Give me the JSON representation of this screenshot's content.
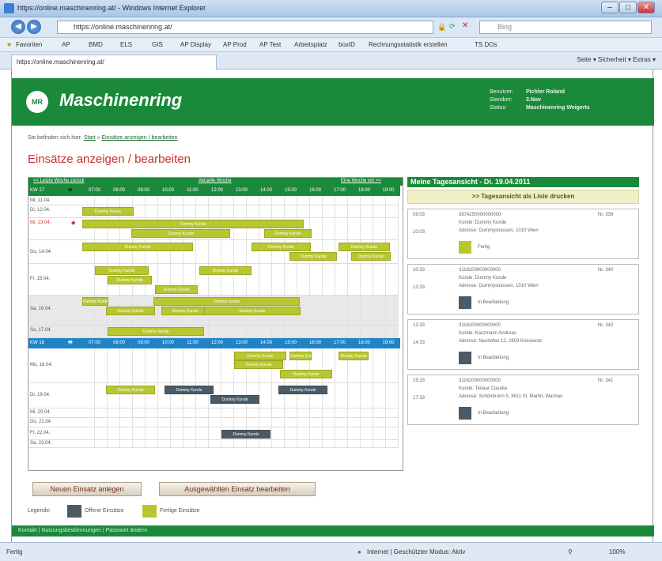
{
  "window": {
    "title": "https://online.maschinenring.at/ - Windows Internet Explorer",
    "url": "https://online.maschinenring.at/",
    "search_placeholder": "Bing"
  },
  "favorites": {
    "label": "Favoriten",
    "items": [
      "AP",
      "BMD",
      "ELS",
      "GIS",
      "AP Display",
      "AP Prod",
      "AP Test",
      "Arbeitsplatz",
      "boxID",
      "Rechnungsstatistik erstellen",
      "TS DOs"
    ]
  },
  "tab": {
    "label": "https://online.maschinenring.at/",
    "tools": "Seite ▾  Sicherheit ▾  Extras ▾"
  },
  "header": {
    "brand": "Maschinenring",
    "logo_text": "MR",
    "user_labels": [
      "Benutzer:",
      "Standort:",
      "Status:"
    ],
    "user_values": [
      "Pichler Roland",
      "3.Nov",
      "Maschinenring Weigerts"
    ]
  },
  "breadcrumb": {
    "prefix": "Sie befinden sich hier:",
    "start": "Start",
    "current": "Einsätze anzeigen / bearbeiten"
  },
  "page_title": "Einsätze anzeigen / bearbeiten",
  "calendar": {
    "prev_week": "<< Letzte Woche zurück",
    "current_week": "Aktuelle Woche",
    "next_week": "Eine Woche vor >>",
    "week1": "KW 17",
    "week2": "KW 18",
    "hours": [
      "07:00",
      "08:00",
      "09:00",
      "10:00",
      "11:00",
      "12:00",
      "13:00",
      "14:00",
      "15:00",
      "16:00",
      "17:00",
      "18:00",
      "19:00"
    ],
    "days1": [
      "Mi, 11.04.",
      "Di, 12.04.",
      "Mi, 13.04.",
      "Do, 14.04.",
      "Fr, 15.04.",
      "Sa, 16.04.",
      "So, 17.04."
    ],
    "days2": [
      "Mo, 18.04.",
      "Di, 19.04.",
      "Mi, 20.04.",
      "Do, 21.04.",
      "Fr, 22.04.",
      "Sa, 23.04."
    ],
    "event_labels": {
      "green": "Dummy Kunde",
      "dark": "Dummy Kunde"
    }
  },
  "buttons": {
    "new": "Neuen Einsatz anlegen",
    "edit": "Ausgewählten Einsatz bearbeiten"
  },
  "legend": {
    "label": "Legende:",
    "open": "Offene Einsätze",
    "done": "Fertige Einsätze",
    "open_color": "#4a5a66",
    "done_color": "#b8c630"
  },
  "day_view": {
    "title": "Meine Tagesansicht - Di. 19.04.2011",
    "print": ">> Tagesansicht als Liste drucken",
    "cards": [
      {
        "t1": "09:03",
        "t2": "10:03",
        "id": "3874250000000000",
        "nr": "Nr. 339",
        "kunde": "Kunde: Dummy Kunde",
        "adresse": "Adresse: Dummystrassen, 1010 Wien",
        "status": "Fertig",
        "color": "#b8c630"
      },
      {
        "t1": "10:33",
        "t2": "12:33",
        "id": "3116200000000000",
        "nr": "Nr. 340",
        "kunde": "Kunde: Dummy Kunde",
        "adresse": "Adresse: Dummystrassen, 1010 Wien",
        "status": "In Bearbeitung",
        "color": "#4a5a66"
      },
      {
        "t1": "12:33",
        "t2": "14:33",
        "id": "3116200000000000",
        "nr": "Nr. 342",
        "kunde": "Kunde: Kaczmarin Andreas",
        "adresse": "Adresse: Neuhofen 12, 2803 Krieseestr.",
        "status": "In Bearbeitung",
        "color": "#4a5a66"
      },
      {
        "t1": "15:33",
        "t2": "17:33",
        "id": "3116200000000000",
        "nr": "Nr. 341",
        "kunde": "Kunde: Tedaar Claudia",
        "adresse": "Adresse: Schönbrunn 5, 3611 St. Martin, Wachau",
        "status": "In Bearbeitung",
        "color": "#4a5a66"
      }
    ]
  },
  "footer": "Kontakt  |  Nutzungsbestimmungen  |  Passwort ändern",
  "statusbar": {
    "left": "Fertig",
    "zone": "Internet | Geschützter Modus: Aktiv",
    "zoom": "100%"
  }
}
